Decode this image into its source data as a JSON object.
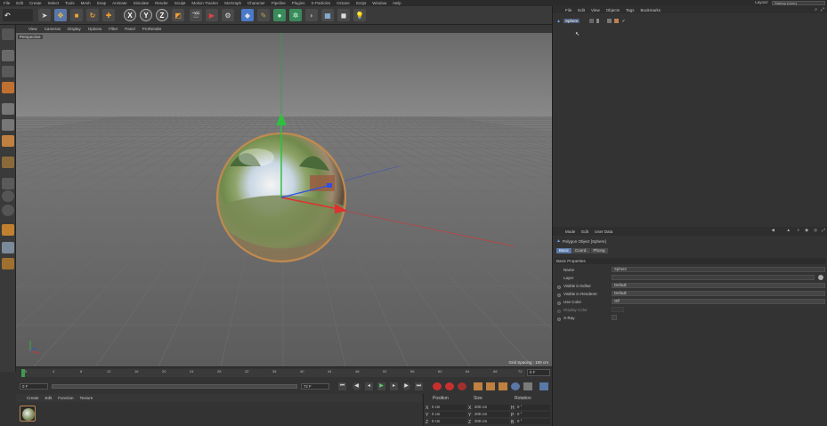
{
  "menubar": {
    "items": [
      "File",
      "Edit",
      "Create",
      "Select",
      "Tools",
      "Mesh",
      "Snap",
      "Animate",
      "Simulate",
      "Render",
      "Sculpt",
      "Motion Tracker",
      "MoGraph",
      "Character",
      "Pipeline",
      "Plugins",
      "X-Particles",
      "Octane",
      "Script",
      "Window",
      "Help"
    ],
    "layout_label": "Layout:",
    "layout_value": "Startup (User)"
  },
  "toolbar": {
    "axis_x": "X",
    "axis_y": "Y",
    "axis_z": "Z"
  },
  "viewport": {
    "menu": [
      "View",
      "Cameras",
      "Display",
      "Options",
      "Filter",
      "Panel",
      "ProRender"
    ],
    "camera_label": "Perspective",
    "grid_spacing": "Grid Spacing : 100 cm"
  },
  "timeline": {
    "ticks": [
      "0",
      "4",
      "8",
      "12",
      "16",
      "20",
      "24",
      "28",
      "32",
      "36",
      "40",
      "44",
      "48",
      "52",
      "56",
      "60",
      "64",
      "68",
      "72"
    ],
    "end_frame_label": "0 F",
    "current_frame": "0 F",
    "start_field": "0 F",
    "end_field": "72 F",
    "max_field": "72 F"
  },
  "material_manager": {
    "menu": [
      "Create",
      "Edit",
      "Function",
      "Texture"
    ]
  },
  "coordinates": {
    "headers": [
      "Position",
      "Size",
      "Rotation"
    ],
    "rows": [
      {
        "axis": "X",
        "pos": "0 cm",
        "size_axis": "X",
        "size": "200 cm",
        "rot_axis": "H",
        "rot": "0 °"
      },
      {
        "axis": "Y",
        "pos": "0 cm",
        "size_axis": "Y",
        "size": "200 cm",
        "rot_axis": "P",
        "rot": "0 °"
      },
      {
        "axis": "Z",
        "pos": "0 cm",
        "size_axis": "Z",
        "size": "200 cm",
        "rot_axis": "B",
        "rot": "0 °"
      }
    ]
  },
  "object_manager": {
    "menu": [
      "File",
      "Edit",
      "View",
      "Objects",
      "Tags",
      "Bookmarks"
    ],
    "object_name": "Sphere"
  },
  "attributes": {
    "menu": [
      "Mode",
      "Edit",
      "User Data"
    ],
    "object_title": "Polygon Object [Sphere]",
    "tabs": [
      "Basic",
      "Coord.",
      "Phong"
    ],
    "section": "Basic Properties",
    "props": [
      {
        "label": "Name",
        "value": "Sphere"
      },
      {
        "label": "Layer",
        "value": ""
      },
      {
        "label": "Visible in Editor",
        "value": "Default"
      },
      {
        "label": "Visible in Renderer",
        "value": "Default"
      },
      {
        "label": "Use Color",
        "value": "Off"
      },
      {
        "label": "Display Color",
        "value": ""
      },
      {
        "label": "X-Ray",
        "value": ""
      }
    ]
  },
  "colors": {
    "accent_blue": "#5a77a8",
    "axis_red": "#e03030",
    "axis_green": "#30c040",
    "axis_blue": "#3050e0",
    "sphere_rim": "#c08a50"
  }
}
